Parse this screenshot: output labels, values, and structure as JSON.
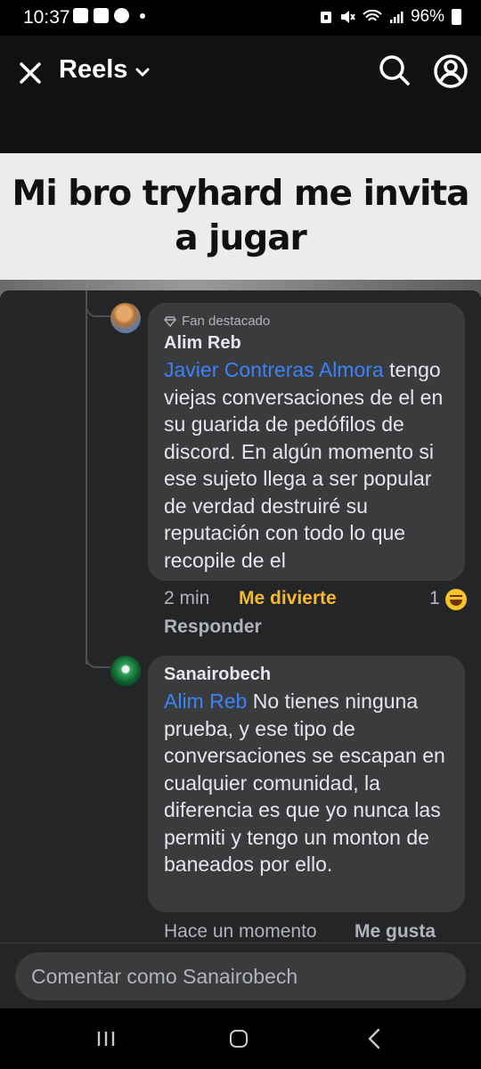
{
  "status": {
    "time": "10:37",
    "battery": "96%",
    "notification_icons": [
      "gallery-icon",
      "mail-icon",
      "messenger-icon",
      "dot"
    ],
    "system_icons": [
      "alarm-icon",
      "mute-icon",
      "wifi-icon",
      "signal-icon",
      "battery-icon"
    ]
  },
  "header": {
    "title": "Reels"
  },
  "video": {
    "caption": "Mi bro tryhard me invita a jugar"
  },
  "comments": [
    {
      "badge": "Fan destacado",
      "author": "Alim Reb",
      "mention": "Javier Contreras Almora",
      "text": "tengo viejas conversaciones de el en su guarida de pedófilos de discord. En algún momento si ese sujeto llega a ser popular de verdad destruiré su reputación con todo lo que recopile de el",
      "time": "2 min",
      "reaction_label": "Me divierte",
      "reply_label": "Responder",
      "reaction_count": "1"
    },
    {
      "author": "Sanairobech",
      "mention": "Alim Reb",
      "text": "No tienes ninguna prueba, y ese tipo de conversaciones se escapan en cualquier comunidad, la diferencia es que yo nunca las permiti y tengo un monton de baneados por ello.",
      "time": "Hace un momento",
      "like_label": "Me gusta"
    }
  ],
  "composer": {
    "placeholder": "Comentar como Sanairobech"
  },
  "colors": {
    "background": "#242526",
    "bubble": "#3a3b3c",
    "mention": "#3b82f6",
    "haha": "#f7b928"
  }
}
